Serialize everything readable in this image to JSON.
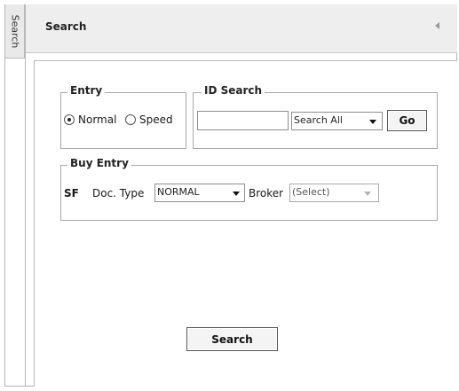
{
  "side_tab": {
    "label": "Search"
  },
  "header": {
    "title": "Search"
  },
  "entry_group": {
    "legend": "Entry",
    "options": [
      {
        "label": "Normal",
        "selected": true
      },
      {
        "label": "Speed",
        "selected": false
      }
    ]
  },
  "id_search_group": {
    "legend": "ID Search",
    "input_value": "",
    "select_value": "Search All",
    "go_label": "Go"
  },
  "buy_entry_group": {
    "legend": "Buy Entry",
    "sf_label": "SF",
    "doc_type_label": "Doc. Type",
    "doc_type_value": "NORMAL",
    "broker_label": "Broker",
    "broker_value": "(Select)"
  },
  "search_button_label": "Search",
  "icons": {
    "collapse": "triangle-left-icon",
    "dropdown": "triangle-down-icon"
  }
}
